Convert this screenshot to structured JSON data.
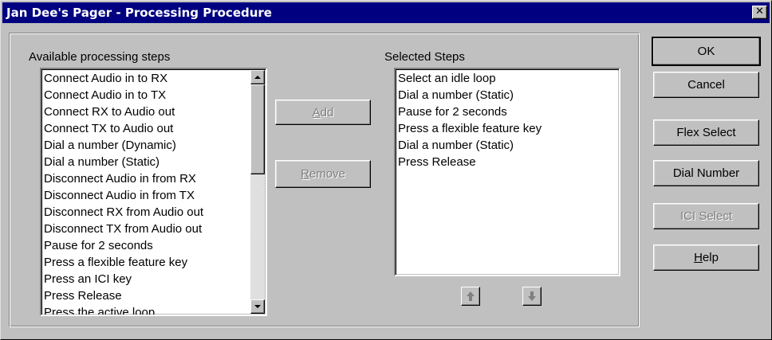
{
  "window": {
    "title": "Jan Dee's Pager - Processing Procedure",
    "close_glyph": "✕"
  },
  "available": {
    "label": "Available processing steps",
    "items": [
      "Connect Audio in to RX",
      "Connect Audio in to TX",
      "Connect RX to Audio out",
      "Connect TX to Audio out",
      "Dial a number (Dynamic)",
      "Dial a number (Static)",
      "Disconnect Audio in from RX",
      "Disconnect Audio in from TX",
      "Disconnect RX from Audio out",
      "Disconnect TX from Audio out",
      "Pause for 2 seconds",
      "Press a flexible feature key",
      "Press an ICI key",
      "Press Release",
      "Press the active loop"
    ]
  },
  "selected": {
    "label": "Selected Steps",
    "items": [
      "Select an idle loop",
      "Dial a number (Static)",
      "Pause for 2 seconds",
      "Press a flexible feature key",
      "Dial a number (Static)",
      "Press Release"
    ]
  },
  "buttons": {
    "add": {
      "mnemonic": "A",
      "rest": "dd",
      "enabled": false
    },
    "remove": {
      "mnemonic": "R",
      "rest": "emove",
      "enabled": false
    },
    "ok": {
      "label": "OK"
    },
    "cancel": {
      "label": "Cancel"
    },
    "flex_select": {
      "label": "Flex Select"
    },
    "dial_number": {
      "label": "Dial Number"
    },
    "ici_select": {
      "label": "ICI Select",
      "enabled": false
    },
    "help": {
      "mnemonic": "H",
      "rest": "elp"
    }
  },
  "icons": {
    "move_up": "arrow-up-icon",
    "move_down": "arrow-down-icon",
    "scroll_up": "scroll-up-icon",
    "scroll_down": "scroll-down-icon"
  }
}
